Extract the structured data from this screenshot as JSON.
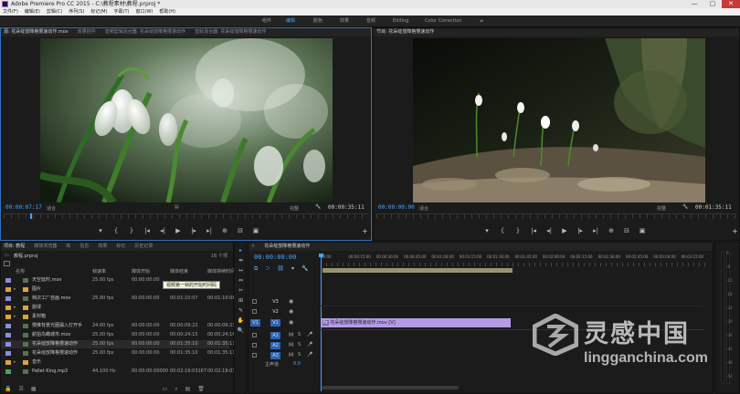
{
  "window": {
    "title": "Adobe Premiere Pro CC 2015 - C:\\教程素材\\教程.prproj *",
    "controls": [
      "—",
      "▢",
      "✕"
    ]
  },
  "menu": [
    "文件(F)",
    "编辑(E)",
    "剪辑(C)",
    "序列(S)",
    "标记(M)",
    "字幕(T)",
    "窗口(W)",
    "帮助(H)"
  ],
  "workspaces": [
    "组件",
    "编辑",
    "颜色",
    "效果",
    "音频",
    "Editing",
    "Color Correction"
  ],
  "workspace_more": "»",
  "source": {
    "tabs": [
      "源: 花朵绽放降格慢速动作.mov",
      "效果控件",
      "音频剪辑混合器: 花朵绽放降格慢速动作",
      "音轨混合器: 花朵绽放降格慢速动作"
    ],
    "timecode_in": "00:00:07:17",
    "fit": "适合",
    "quality": "完整",
    "duration": "00:00:35:11"
  },
  "program": {
    "tabs": [
      "节目: 花朵绽放降格慢速动作"
    ],
    "timecode": "00:00:00:00",
    "fit": "适合",
    "quality": "完整",
    "duration": "00:01:35:11"
  },
  "transport_glyphs": [
    "▾",
    "{",
    "}",
    "|◂",
    "◂|",
    "▶",
    "|▸",
    "▸|",
    "⊕",
    "⊟",
    "▣",
    "◫"
  ],
  "project": {
    "tabs": [
      "项目: 教程",
      "媒体浏览器",
      "库",
      "信息",
      "效果",
      "标记",
      "历史记录"
    ],
    "file": "教程.prproj",
    "count": "16 个项",
    "columns": [
      "名称",
      "帧速率",
      "媒体开始",
      "媒体结束",
      "媒体持续时间"
    ],
    "tooltip": "视频第一帧的开始时间码",
    "rows": [
      {
        "name": "天空延时.mov",
        "fps": "25.00 fps",
        "start": "00:00:00:00",
        "end": "",
        "dur": "",
        "color": "#8c8ce0",
        "type": "clip"
      },
      {
        "name": "图片",
        "fps": "",
        "start": "",
        "end": "",
        "dur": "",
        "color": "#d9a441",
        "type": "bin"
      },
      {
        "name": "档次工厂自画.mov",
        "fps": "25.00 fps",
        "start": "00:00:00:00",
        "end": "00:01:10:07",
        "dur": "00:01:10:08",
        "color": "#8c8ce0",
        "type": "clip"
      },
      {
        "name": "旋球",
        "fps": "",
        "start": "",
        "end": "",
        "dur": "",
        "color": "#d9a441",
        "type": "bin"
      },
      {
        "name": "素材箱",
        "fps": "",
        "start": "",
        "end": "",
        "dur": "",
        "color": "#d9a441",
        "type": "bin"
      },
      {
        "name": "慢推背景光圈漏入灯开手",
        "fps": "24.00 fps",
        "start": "00:00:00:00",
        "end": "00:00:09:22",
        "dur": "00:00:09:23",
        "color": "#8c8ce0",
        "type": "clip"
      },
      {
        "name": "航拍鸟瞰城市.mov",
        "fps": "25.00 fps",
        "start": "00:00:00:00",
        "end": "00:00:24:15",
        "dur": "00:00:24:16",
        "color": "#8c8ce0",
        "type": "clip"
      },
      {
        "name": "花朵绽放降格慢速动作",
        "fps": "25.00 fps",
        "start": "00:00:00:00",
        "end": "00:01:35:10",
        "dur": "00:01:35:11",
        "color": "#46a05a",
        "type": "clip"
      },
      {
        "name": "花朵绽放降格慢速动作",
        "fps": "25.00 fps",
        "start": "00:00:00:00",
        "end": "00:01:35:10",
        "dur": "00:01:35:11",
        "color": "#8c8ce0",
        "type": "clip"
      },
      {
        "name": "音乐",
        "fps": "",
        "start": "",
        "end": "",
        "dur": "",
        "color": "#d9a441",
        "type": "bin"
      },
      {
        "name": "Pallet King.mp3",
        "fps": "44,100 Hz",
        "start": "00:00:00:00000",
        "end": "00:02:19:03167",
        "dur": "00:02:19:03168",
        "color": "#46a05a",
        "type": "audio"
      }
    ]
  },
  "timeline": {
    "tab": "花朵绽放降格慢速动作",
    "timecode": "00:00:00:00",
    "ruler": [
      "00:00",
      "00:00:15:00",
      "00:00:30:00",
      "00:00:45:00",
      "00:01:00:00",
      "00:01:15:00",
      "00:01:30:00",
      "00:01:45:00",
      "00:02:00:00",
      "00:02:15:00",
      "00:02:30:00",
      "00:02:45:00",
      "00:03:00:00",
      "00:03:15:00"
    ],
    "tracks": [
      {
        "label": "V3",
        "kind": "video"
      },
      {
        "label": "V2",
        "kind": "video"
      },
      {
        "label": "V1",
        "kind": "video",
        "active": true
      },
      {
        "label": "A1",
        "kind": "audio",
        "active": true
      },
      {
        "label": "A2",
        "kind": "audio",
        "active": true
      },
      {
        "label": "A3",
        "kind": "audio",
        "active": true
      }
    ],
    "master": "主声道",
    "master_value": "0.0",
    "clip_label": "花朵绽放降格慢速动作.mov [V]",
    "clip_fx": "fx"
  },
  "tools": [
    "▸",
    "⇹",
    "↔",
    "⇔",
    "◇",
    "✂",
    "⊞",
    "✎",
    "✋",
    "🔍"
  ],
  "meter_scale": [
    "0",
    "-6",
    "-12",
    "-18",
    "-24",
    "-30",
    "-36",
    "-42",
    "-48",
    "-54"
  ],
  "watermark": {
    "title": "灵感中国",
    "url": "lingganchina.com"
  },
  "colors": {
    "accent": "#4aa3ff",
    "clip": "#b49be8",
    "track_active": "#2c64b5",
    "work_area": "#9a9270"
  }
}
